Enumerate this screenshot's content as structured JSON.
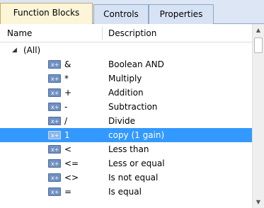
{
  "tabs": [
    "Function Blocks",
    "Controls",
    "Properties"
  ],
  "columns": {
    "name": "Name",
    "description": "Description"
  },
  "group": {
    "label": "(All)",
    "expander": "◢"
  },
  "rows": [
    {
      "symbol": "&",
      "description": "Boolean AND",
      "selected": false
    },
    {
      "symbol": "*",
      "description": "Multiply",
      "selected": false
    },
    {
      "symbol": "+",
      "description": "Addition",
      "selected": false
    },
    {
      "symbol": "-",
      "description": "Subtraction",
      "selected": false
    },
    {
      "symbol": "/",
      "description": "Divide",
      "selected": false
    },
    {
      "symbol": "1",
      "description": "copy (1 gain)",
      "selected": true
    },
    {
      "symbol": "<",
      "description": "Less than",
      "selected": false
    },
    {
      "symbol": "<=",
      "description": "Less or equal",
      "selected": false
    },
    {
      "symbol": "<>",
      "description": "Is not equal",
      "selected": false
    },
    {
      "symbol": "=",
      "description": "Is equal",
      "selected": false
    }
  ],
  "scrollbar": {
    "up": "▲",
    "down": "▼"
  },
  "colors": {
    "selection": "#3399ff",
    "active_tab": "#fdf5d8",
    "tabbar": "#dce6f4"
  },
  "icons": {
    "row_icon": "function-block-icon"
  }
}
